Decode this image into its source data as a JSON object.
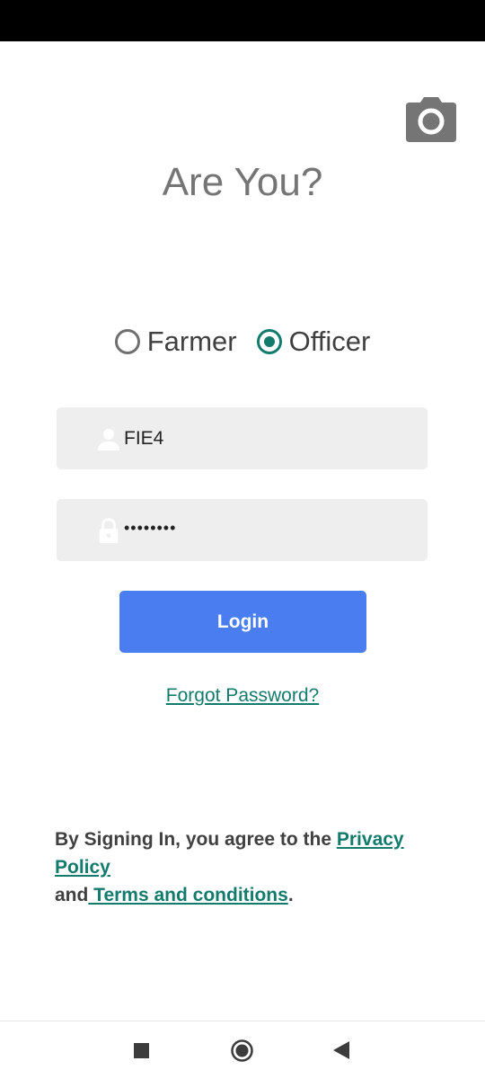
{
  "screen": {
    "title": "Are You?"
  },
  "role_selector": {
    "options": [
      {
        "label": "Farmer",
        "selected": false
      },
      {
        "label": "Officer",
        "selected": true
      }
    ]
  },
  "login_form": {
    "username_value": "FIE4",
    "password_value": "••••••••",
    "login_label": "Login",
    "forgot_label": "Forgot Password?"
  },
  "terms": {
    "prefix": "By Signing In, you agree to the ",
    "privacy_label": "Privacy Policy",
    "middle": "and",
    "terms_label": " Terms and conditions",
    "suffix": "."
  },
  "icons": {
    "camera": "camera-icon",
    "user": "user-icon",
    "lock": "lock-icon",
    "recents": "nav-recents-icon",
    "home": "nav-home-icon",
    "back": "nav-back-icon"
  },
  "colors": {
    "accent": "#137b6c",
    "button": "#4a7def",
    "field_bg": "#eeeeee",
    "title": "#757575"
  }
}
